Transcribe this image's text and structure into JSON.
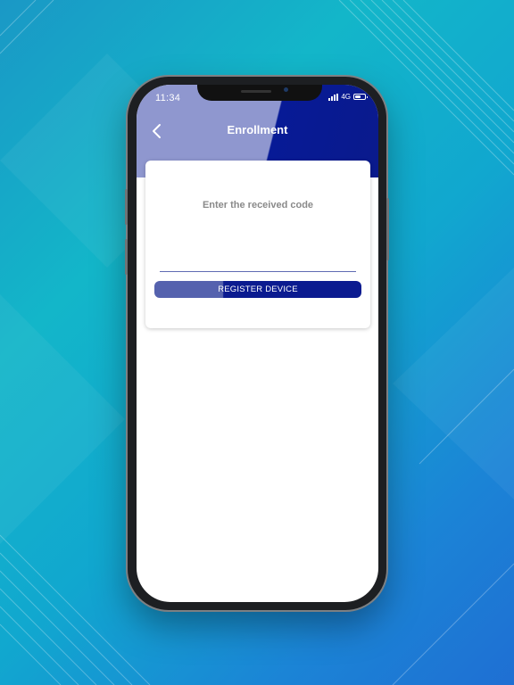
{
  "status_bar": {
    "time": "11:34",
    "network": "4G",
    "signal_icon": "signal-bars-icon",
    "battery_icon": "battery-icon"
  },
  "header": {
    "title": "Enrollment",
    "back_icon": "chevron-left-icon"
  },
  "enrollment_card": {
    "prompt": "Enter the received code",
    "code_value": "",
    "register_label": "REGISTER DEVICE"
  },
  "colors": {
    "primary": "#0b1b90",
    "primary_light": "#8f97cf",
    "button_light": "#5562ae"
  }
}
